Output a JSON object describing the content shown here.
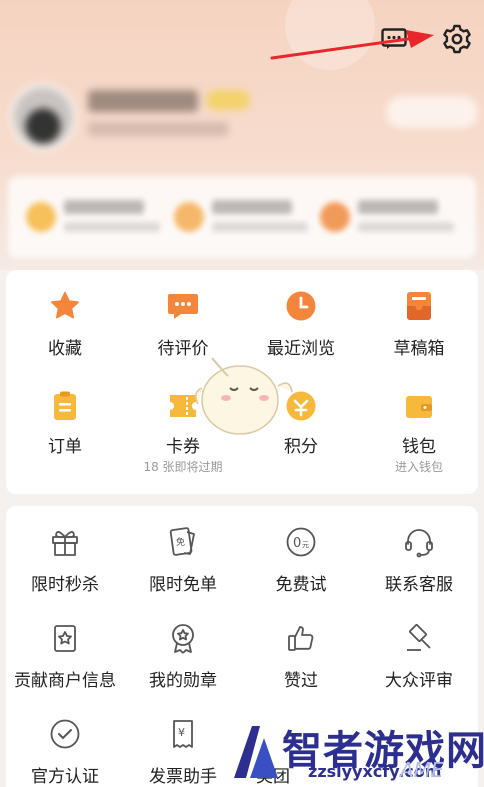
{
  "colors": {
    "accent_orange": "#f59a3c",
    "header_peach": "#f6d3c1",
    "watermark_blue": "#2c2f8f"
  },
  "top_icons": [
    {
      "icon": "message-icon"
    },
    {
      "icon": "gear-icon"
    }
  ],
  "section1": {
    "items": [
      {
        "icon": "star-icon",
        "label": "收藏"
      },
      {
        "icon": "comment-icon",
        "label": "待评价"
      },
      {
        "icon": "clock-icon",
        "label": "最近浏览"
      },
      {
        "icon": "drafts-box-icon",
        "label": "草稿箱"
      },
      {
        "icon": "clipboard-icon",
        "label": "订单"
      },
      {
        "icon": "ticket-icon",
        "label": "卡券",
        "sub": "18 张即将过期"
      },
      {
        "icon": "points-icon",
        "label": "积分"
      },
      {
        "icon": "wallet-icon",
        "label": "钱包",
        "sub": "进入钱包"
      }
    ]
  },
  "section2": {
    "items": [
      {
        "icon": "gift-icon",
        "label": "限时秒杀"
      },
      {
        "icon": "free-coupon-icon",
        "label": "限时免单"
      },
      {
        "icon": "zero-yuan-icon",
        "label": "免费试"
      },
      {
        "icon": "headset-icon",
        "label": "联系客服"
      },
      {
        "icon": "shop-info-icon",
        "label": "贡献商户信息"
      },
      {
        "icon": "medal-icon",
        "label": "我的勋章"
      },
      {
        "icon": "thumbs-up-icon",
        "label": "赞过"
      },
      {
        "icon": "gavel-icon",
        "label": "大众评审"
      },
      {
        "icon": "check-circle-icon",
        "label": "官方认证"
      },
      {
        "icon": "invoice-icon",
        "label": "发票助手"
      },
      {
        "icon": "partial-icon",
        "label": "美团"
      }
    ]
  },
  "watermark": {
    "text": "智者游戏网",
    "url": "zzslyyxcfy.com",
    "faded": "AME"
  }
}
